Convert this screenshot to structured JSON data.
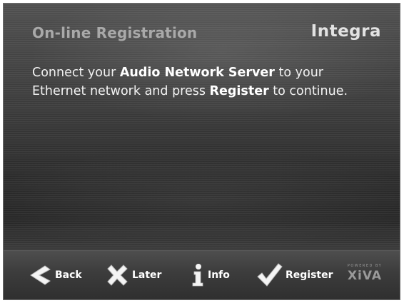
{
  "header": {
    "title": "On-line Registration",
    "brand": "Integra"
  },
  "message": {
    "part1": "Connect your ",
    "server": "Audio Network Server",
    "part2": " to your Ethernet network and press ",
    "register": "Register",
    "part3": " to continue."
  },
  "buttons": {
    "back": "Back",
    "later": "Later",
    "info": "Info",
    "register": "Register"
  },
  "badge": {
    "powered": "POWERED BY",
    "name": "XiVA"
  },
  "icons": {
    "back": "chevron-left-icon",
    "later": "x-cross-icon",
    "info": "info-icon",
    "register": "checkmark-icon"
  }
}
